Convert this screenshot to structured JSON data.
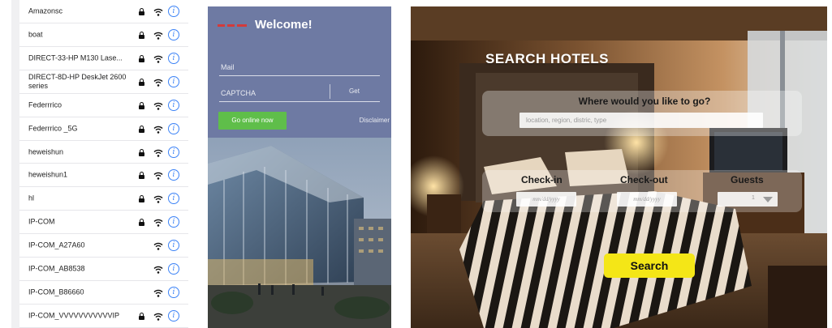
{
  "wifi": {
    "networks": [
      {
        "name": "Amazonsc",
        "secured": true
      },
      {
        "name": "boat",
        "secured": true
      },
      {
        "name": "DIRECT-33-HP M130 Lase...",
        "secured": true
      },
      {
        "name": "DIRECT-8D-HP DeskJet 2600 series",
        "secured": true
      },
      {
        "name": "Federrrico",
        "secured": true
      },
      {
        "name": "Federrrico _5G",
        "secured": true
      },
      {
        "name": "heweishun",
        "secured": true
      },
      {
        "name": "heweishun1",
        "secured": true
      },
      {
        "name": "hl",
        "secured": true
      },
      {
        "name": "IP-COM",
        "secured": true
      },
      {
        "name": "IP-COM_A27A60",
        "secured": false
      },
      {
        "name": "IP-COM_AB8538",
        "secured": false
      },
      {
        "name": "IP-COM_B86660",
        "secured": false
      },
      {
        "name": "IP-COM_VVVVVVVVVVVIP",
        "secured": true
      }
    ],
    "info_glyph": "i",
    "icons": {
      "lock": "lock-icon",
      "signal": "wifi-icon",
      "info": "info-icon"
    },
    "accent_color": "#3b82f6"
  },
  "portal": {
    "title": "Welcome!",
    "mail_placeholder": "Mail",
    "captcha_placeholder": "CAPTCHA",
    "get_label": "Get",
    "online_button": "Go online now",
    "disclaimer": "Disclaimer",
    "background_color": "#6e7aa3",
    "button_color": "#5fbe4a"
  },
  "hotel": {
    "heading": "SEARCH HOTELS",
    "where_label": "Where would you like to go?",
    "where_placeholder": "location, region, distric, type",
    "checkin_label": "Check-in",
    "checkout_label": "Check-out",
    "guests_label": "Guests",
    "date_placeholder": "mm/dd/yyyy",
    "guests_value": "1",
    "search_button": "Search",
    "button_color": "#f4e617"
  }
}
